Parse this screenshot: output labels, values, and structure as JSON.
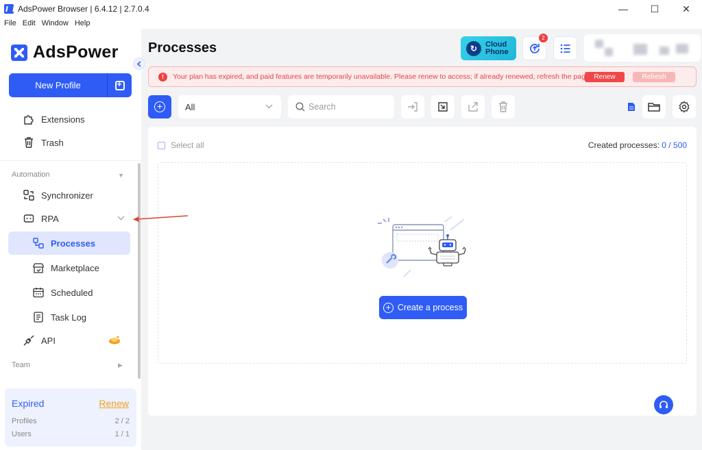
{
  "window": {
    "title": "AdsPower Browser | 6.4.12 | 2.7.0.4",
    "minimize": "—",
    "maximize": "☐",
    "close": "✕"
  },
  "menu": [
    "File",
    "Edit",
    "Window",
    "Help"
  ],
  "sidebar": {
    "logo": "AdsPower",
    "new_profile": "New Profile",
    "items": {
      "extensions": "Extensions",
      "trash": "Trash",
      "automation": "Automation",
      "synchronizer": "Synchronizer",
      "rpa": "RPA",
      "processes": "Processes",
      "marketplace": "Marketplace",
      "scheduled": "Scheduled",
      "task_log": "Task Log",
      "api": "API",
      "team": "Team"
    },
    "plan": {
      "status": "Expired",
      "renew": "Renew",
      "profiles_label": "Profiles",
      "profiles_value": "2 / 2",
      "users_label": "Users",
      "users_value": "1 / 1"
    }
  },
  "header": {
    "title": "Processes",
    "cloud_phone_line1": "Cloud",
    "cloud_phone_line2": "Phone",
    "notification_count": "2"
  },
  "alert": {
    "message": "Your plan has expired, and paid features are temporarily unavailable. Please renew to access; if already renewed, refresh the page.",
    "renew": "Renew",
    "refresh": "Refresh"
  },
  "toolbar": {
    "filter_value": "All",
    "search_placeholder": "Search"
  },
  "content": {
    "select_all": "Select all",
    "created_label": "Created processes:",
    "created_count": "0 / 500",
    "create_button": "Create a process"
  },
  "colors": {
    "accent": "#2f5cf5",
    "alert": "#ee4040",
    "renew_link": "#f0a020",
    "annotation_arrow": "#d9442e"
  }
}
